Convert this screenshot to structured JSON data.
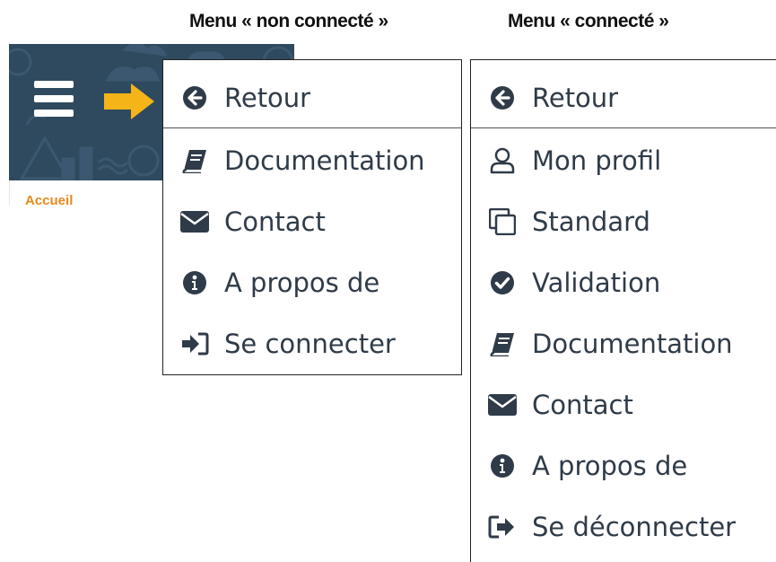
{
  "captions": {
    "left": "Menu « non connecté »",
    "right": "Menu « connecté »"
  },
  "header": {
    "background_color": "#2f4a5e",
    "arrow_color": "#f5b417",
    "breadcrumb": "Accueil",
    "breadcrumb_color": "#e8891c"
  },
  "menu_guest": {
    "items": [
      {
        "label": "Retour",
        "icon": "arrow-circle-left-icon"
      },
      {
        "label": "Documentation",
        "icon": "book-icon"
      },
      {
        "label": "Contact",
        "icon": "envelope-icon"
      },
      {
        "label": "A propos de",
        "icon": "info-circle-icon"
      },
      {
        "label": "Se connecter",
        "icon": "sign-in-icon"
      }
    ]
  },
  "menu_user": {
    "items": [
      {
        "label": "Retour",
        "icon": "arrow-circle-left-icon"
      },
      {
        "label": "Mon profil",
        "icon": "user-icon"
      },
      {
        "label": "Standard",
        "icon": "copy-icon"
      },
      {
        "label": "Validation",
        "icon": "check-circle-icon"
      },
      {
        "label": "Documentation",
        "icon": "book-icon"
      },
      {
        "label": "Contact",
        "icon": "envelope-icon"
      },
      {
        "label": "A propos de",
        "icon": "info-circle-icon"
      },
      {
        "label": "Se déconnecter",
        "icon": "sign-out-icon"
      }
    ]
  },
  "text_color": "#2f3b48"
}
